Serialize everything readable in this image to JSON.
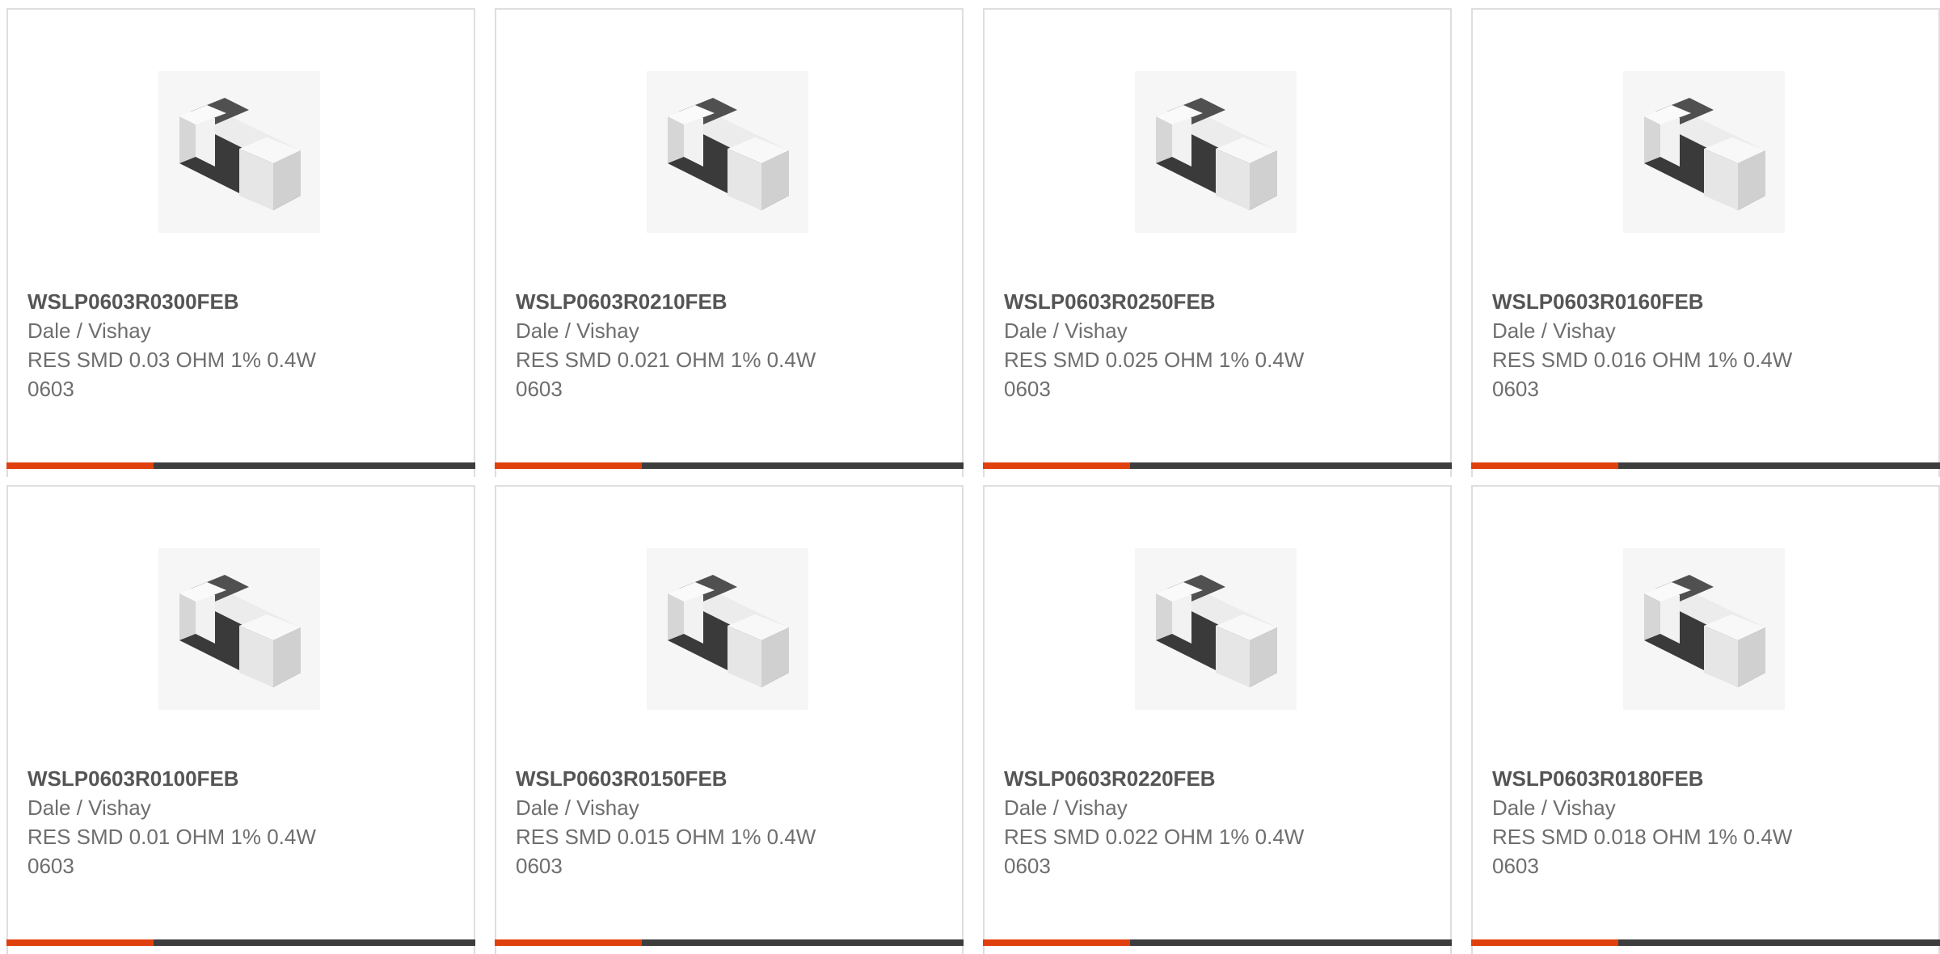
{
  "colors": {
    "accent": "#e0400e",
    "bar": "#3d3d3d",
    "card_border": "#dedede",
    "part_text": "#555555",
    "body_text": "#6e6e6e"
  },
  "products": [
    {
      "part_number": "WSLP0603R0300FEB",
      "manufacturer": "Dale / Vishay",
      "description": "RES SMD 0.03 OHM 1% 0.4W 0603",
      "image_icon": "smd-resistor-icon"
    },
    {
      "part_number": "WSLP0603R0210FEB",
      "manufacturer": "Dale / Vishay",
      "description": "RES SMD 0.021 OHM 1% 0.4W 0603",
      "image_icon": "smd-resistor-icon"
    },
    {
      "part_number": "WSLP0603R0250FEB",
      "manufacturer": "Dale / Vishay",
      "description": "RES SMD 0.025 OHM 1% 0.4W 0603",
      "image_icon": "smd-resistor-icon"
    },
    {
      "part_number": "WSLP0603R0160FEB",
      "manufacturer": "Dale / Vishay",
      "description": "RES SMD 0.016 OHM 1% 0.4W 0603",
      "image_icon": "smd-resistor-icon"
    },
    {
      "part_number": "WSLP0603R0100FEB",
      "manufacturer": "Dale / Vishay",
      "description": "RES SMD 0.01 OHM 1% 0.4W 0603",
      "image_icon": "smd-resistor-icon"
    },
    {
      "part_number": "WSLP0603R0150FEB",
      "manufacturer": "Dale / Vishay",
      "description": "RES SMD 0.015 OHM 1% 0.4W 0603",
      "image_icon": "smd-resistor-icon"
    },
    {
      "part_number": "WSLP0603R0220FEB",
      "manufacturer": "Dale / Vishay",
      "description": "RES SMD 0.022 OHM 1% 0.4W 0603",
      "image_icon": "smd-resistor-icon"
    },
    {
      "part_number": "WSLP0603R0180FEB",
      "manufacturer": "Dale / Vishay",
      "description": "RES SMD 0.018 OHM 1% 0.4W 0603",
      "image_icon": "smd-resistor-icon"
    }
  ]
}
